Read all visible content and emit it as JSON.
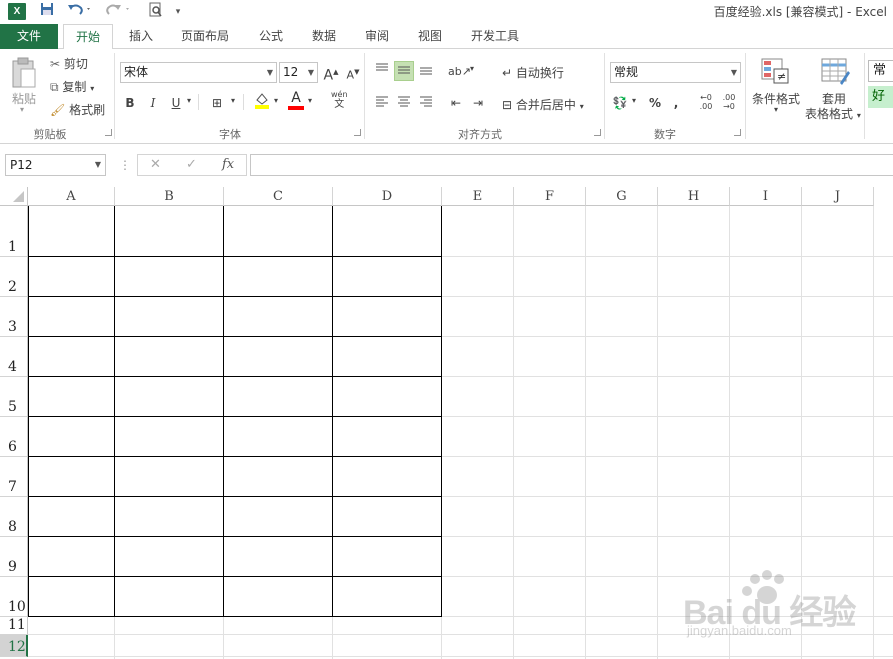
{
  "window": {
    "title": "百度经验.xls  [兼容模式] - Excel",
    "app_logo": "X"
  },
  "quick_access": {
    "save_icon": "save-icon",
    "undo_icon": "undo-icon",
    "redo_icon": "redo-icon",
    "preview_icon": "print-preview-icon"
  },
  "tabs": [
    "文件",
    "开始",
    "插入",
    "页面布局",
    "公式",
    "数据",
    "审阅",
    "视图",
    "开发工具"
  ],
  "active_tab": "开始",
  "ribbon": {
    "clipboard": {
      "label": "剪贴板",
      "paste": "粘贴",
      "cut": "剪切",
      "copy": "复制",
      "format_painter": "格式刷"
    },
    "font": {
      "label": "字体",
      "font_name": "宋体",
      "font_size": "12",
      "grow": "A",
      "shrink": "A",
      "bold": "B",
      "italic": "I",
      "underline": "U",
      "phonetic": "wén",
      "phonetic_sub": "文",
      "font_color_letter": "A",
      "highlight_color": "#ffff00",
      "font_color": "#ff0000"
    },
    "alignment": {
      "label": "对齐方式",
      "wrap_text": "自动换行",
      "merge_center": "合并后居中"
    },
    "number": {
      "label": "数字",
      "format": "常规",
      "percent": "%",
      "comma": ","
    },
    "styles": {
      "conditional_format": "条件格式",
      "table_format_line1": "套用",
      "table_format_line2": "表格格式",
      "style_normal": "常",
      "style_good": "好"
    }
  },
  "formula_bar": {
    "name_box": "P12",
    "cancel": "✕",
    "enter": "✓",
    "fx": "fx",
    "content": ""
  },
  "sheet": {
    "columns": [
      "A",
      "B",
      "C",
      "D",
      "E",
      "F",
      "G",
      "H",
      "I",
      "J"
    ],
    "rows": [
      "1",
      "2",
      "3",
      "4",
      "5",
      "6",
      "7",
      "8",
      "9",
      "10",
      "11",
      "12"
    ],
    "selected_row": "12",
    "bordered_range": "A1:D10"
  },
  "watermark": {
    "brand": "Bai du 经验",
    "url": "jingyan.baidu.com"
  },
  "colors": {
    "accent": "#217346",
    "gridline": "#e1e1e1",
    "header_selected": "#d3d3d3"
  }
}
